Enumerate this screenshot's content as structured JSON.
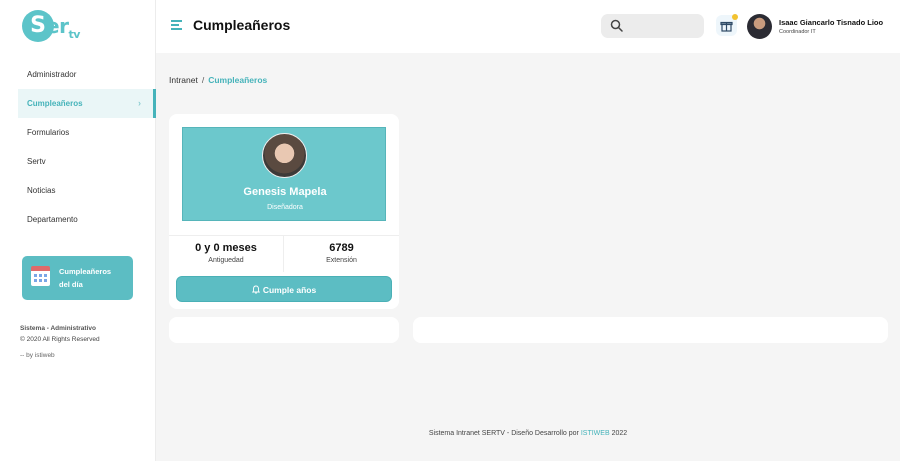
{
  "brand": {
    "logo_s": "S",
    "logo_rest": "er",
    "logo_tv": "tv"
  },
  "header": {
    "title": "Cumpleañeros",
    "user_name": "Isaac Giancarlo Tisnado Lioo",
    "user_role": "Coordinador IT"
  },
  "sidebar": {
    "items": [
      {
        "label": "Administrador"
      },
      {
        "label": "Cumpleañeros",
        "active": true
      },
      {
        "label": "Formularios"
      },
      {
        "label": "Sertv"
      },
      {
        "label": "Noticias"
      },
      {
        "label": "Departamento"
      }
    ],
    "birthday_card": {
      "line1": "Cumpleañeros",
      "line2": "del día"
    },
    "system": {
      "title": "Sistema - Administrativo",
      "rights": "© 2020 All Rights Reserved",
      "by": "-- by istiweb"
    }
  },
  "breadcrumb": {
    "root": "Intranet",
    "sep": "/",
    "current": "Cumpleañeros"
  },
  "profile": {
    "name": "Genesis Mapela",
    "role": "Diseñadora",
    "antiguedad_value": "0 y 0 meses",
    "antiguedad_label": "Antiguedad",
    "extension_value": "6789",
    "extension_label": "Extensión",
    "button_label": "Cumple años"
  },
  "footer": {
    "text": "Sistema Intranet SERTV - Diseño Desarrollo por",
    "link": "ISTIWEB",
    "year": "2022"
  },
  "colors": {
    "accent": "#45b3ba",
    "banner": "#6cc8cc",
    "badge": "#f2c230"
  },
  "icons": [
    "menu-icon",
    "search-icon",
    "gift-icon",
    "calendar-icon",
    "bell-icon",
    "chevron-right-icon"
  ]
}
